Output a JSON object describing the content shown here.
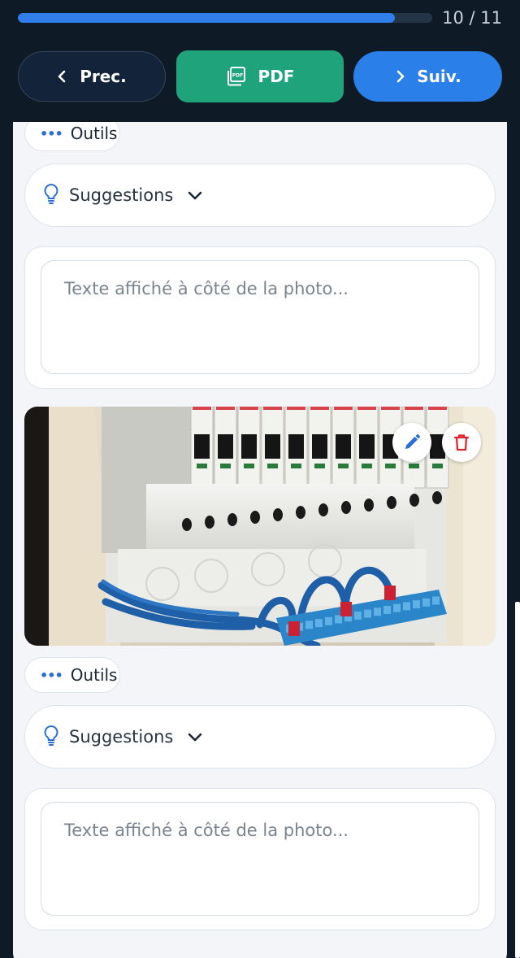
{
  "progress": {
    "count_label": "10 / 11",
    "fraction": 0.909,
    "fill_color": "#2f7ee9"
  },
  "nav": {
    "prev_label": "Prec.",
    "pdf_label": "PDF",
    "next_label": "Suiv."
  },
  "icons": {
    "prev": "chevron-left-icon",
    "pdf": "pdf-file-icon",
    "next": "chevron-right-icon",
    "tools": "ellipsis-icon",
    "suggestions": "lightbulb-icon",
    "dropdown": "chevron-down-icon",
    "edit": "pencil-icon",
    "delete": "trash-icon"
  },
  "colors": {
    "header_bg": "#0f1a27",
    "pdf_green": "#1fa37a",
    "next_blue": "#2b7fe8",
    "accent_blue": "#2b6fd6",
    "delete_red": "#e0202a"
  },
  "sections": [
    {
      "tools_label": "Outils",
      "suggestions_label": "Suggestions",
      "caption_placeholder": "Texte affiché à côté de la photo..."
    },
    {
      "tools_label": "Outils",
      "suggestions_label": "Suggestions",
      "caption_placeholder": "Texte affiché à côté de la photo..."
    }
  ]
}
